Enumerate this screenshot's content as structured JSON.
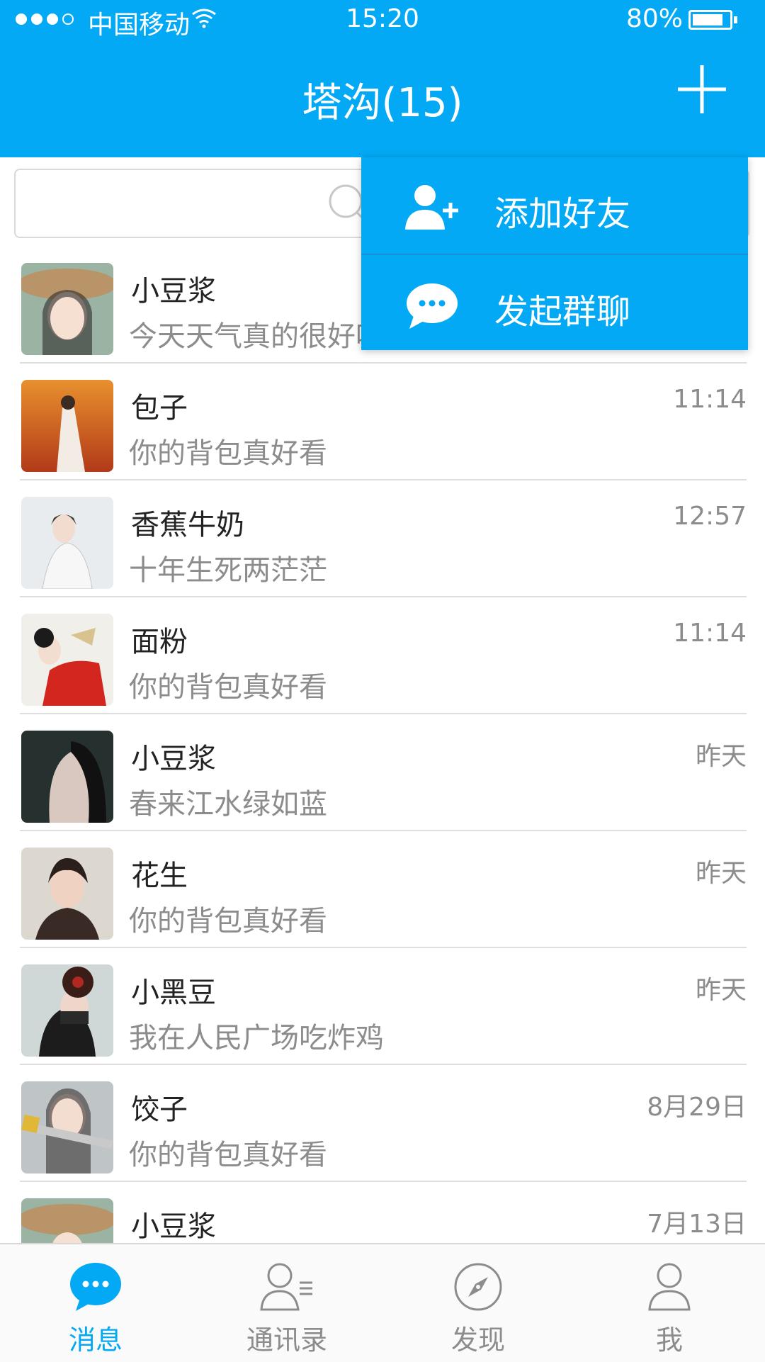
{
  "status_bar": {
    "carrier": "中国移动",
    "time": "15:20",
    "battery": "80%",
    "battery_level": 0.8
  },
  "header": {
    "title": "塔沟(15)"
  },
  "search": {
    "placeholder": ""
  },
  "dropdown": {
    "items": [
      {
        "label": "添加好友",
        "icon": "add-friend-icon"
      },
      {
        "label": "发起群聊",
        "icon": "group-chat-icon"
      }
    ]
  },
  "conversations": [
    {
      "name": "小豆浆",
      "message": "今天天气真的很好呀",
      "time": ""
    },
    {
      "name": "包子",
      "message": "你的背包真好看",
      "time": "11:14"
    },
    {
      "name": "香蕉牛奶",
      "message": "十年生死两茫茫",
      "time": "12:57"
    },
    {
      "name": "面粉",
      "message": "你的背包真好看",
      "time": "11:14"
    },
    {
      "name": "小豆浆",
      "message": "春来江水绿如蓝",
      "time": "昨天"
    },
    {
      "name": "花生",
      "message": "你的背包真好看",
      "time": "昨天"
    },
    {
      "name": "小黑豆",
      "message": "我在人民广场吃炸鸡",
      "time": "昨天"
    },
    {
      "name": "饺子",
      "message": "你的背包真好看",
      "time": "8月29日"
    },
    {
      "name": "小豆浆",
      "message": "",
      "time": "7月13日"
    }
  ],
  "tabbar": {
    "tabs": [
      {
        "label": "消息",
        "icon": "chat-bubble-icon",
        "active": true
      },
      {
        "label": "通讯录",
        "icon": "contacts-icon",
        "active": false
      },
      {
        "label": "发现",
        "icon": "compass-icon",
        "active": false
      },
      {
        "label": "我",
        "icon": "person-icon",
        "active": false
      }
    ]
  },
  "colors": {
    "accent": "#03A9F4",
    "text_primary": "#222222",
    "text_secondary": "#8c8c8c"
  }
}
